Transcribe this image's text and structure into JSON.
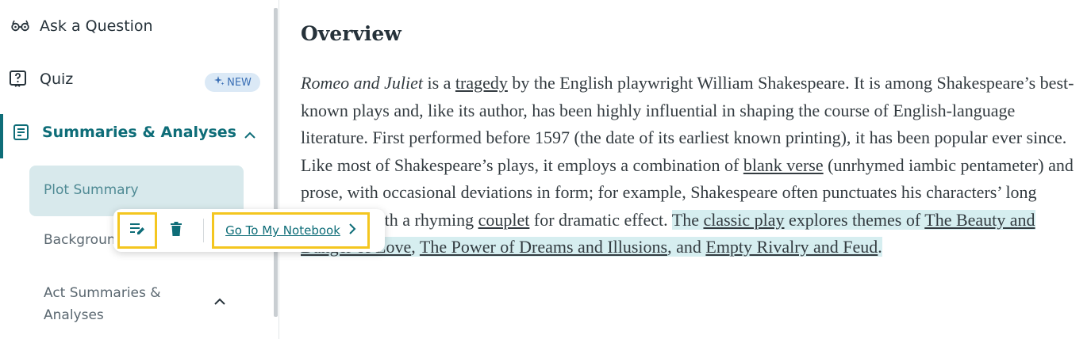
{
  "sidebar": {
    "ask": "Ask a Question",
    "quiz": "Quiz",
    "new_badge": "NEW",
    "summaries": "Summaries & Analyses",
    "plot_summary": "Plot Summary",
    "background": "Backgroun",
    "act_summaries": "Act Summaries & Analyses"
  },
  "toolbar": {
    "notebook_link": "Go To My Notebook"
  },
  "content": {
    "heading": "Overview",
    "p": {
      "s1": "Romeo and Juliet",
      "s2": " is a ",
      "s3": "tragedy",
      "s4": " by the English playwright William Shakespeare. It is among Shakespeare’s best-known plays and, like its author, has been highly influential in shaping the course of English-language literature. First performed before 1597 (the date of its earliest known printing), it has been popular ever since. Like most of Shakespeare’s plays, it employs a combination of ",
      "s5": "blank verse",
      "s6": " (unrhymed iambic pentameter) and ",
      "s7": "prose, with occasional deviations in form; for example, Shakespeare often punctuates his characters’ long speeches with a rhyming ",
      "s8": "couplet",
      "s9": " for dramatic effect. ",
      "h1": "The ",
      "h2": "classic play",
      "h3": " explores themes of ",
      "h4": "The Beauty and Danger of Love",
      "h5": ", ",
      "h6": "The Power of Dreams and Illusions",
      "h7": ", and ",
      "h8": "Empty Rivalry and Feud",
      "h9": "."
    }
  },
  "colors": {
    "accent": "#0e6d78",
    "highlight": "#d6eef0",
    "focus_outline": "#f4c61f",
    "badge_bg": "#dbe9f6"
  }
}
